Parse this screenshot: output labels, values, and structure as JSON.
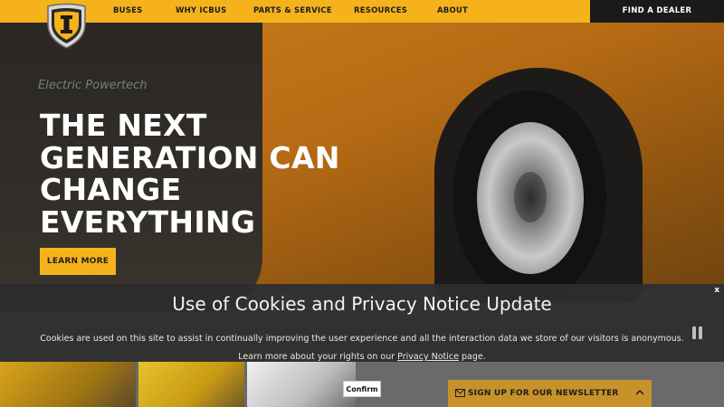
{
  "header": {
    "nav": [
      "BUSES",
      "WHY ICBUS",
      "PARTS & SERVICE",
      "RESOURCES",
      "ABOUT"
    ],
    "dealer_label": "FIND A DEALER"
  },
  "hero": {
    "brand_text": "Electric Powertech",
    "headline": [
      "THE NEXT",
      "GENERATION CAN",
      "CHANGE",
      "EVERYTHING"
    ],
    "cta_label": "LEARN MORE"
  },
  "cookie_banner": {
    "title": "Use of Cookies and Privacy Notice Update",
    "text": "Cookies are used on this site to assist in continually improving the user experience and all the interaction data we store of our visitors is anonymous.",
    "learn_prefix": "Learn more about your rights on our ",
    "learn_link": "Privacy Notice",
    "learn_suffix": " page.",
    "close_label": "x",
    "confirm_label": "Confirm"
  },
  "newsletter": {
    "label": "SIGN UP FOR OUR NEWSLETTER"
  },
  "colors": {
    "brand_yellow": "#f6b21b",
    "dark": "#1a1a1a"
  }
}
